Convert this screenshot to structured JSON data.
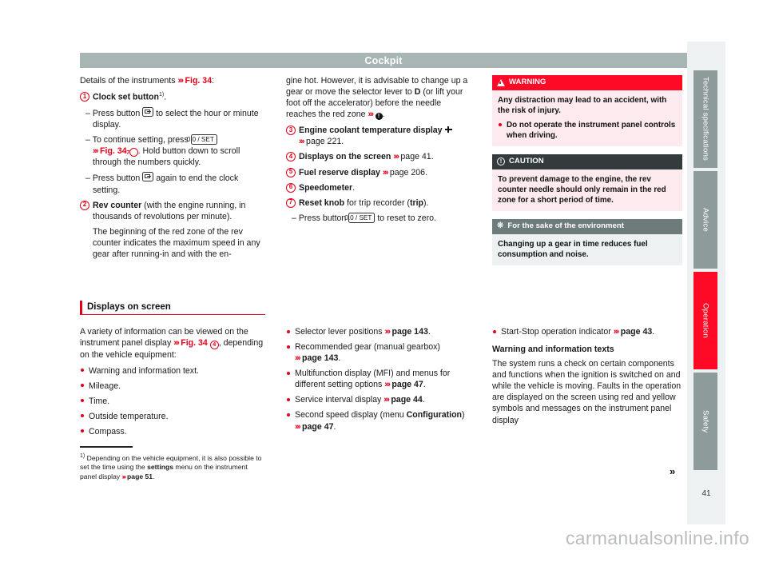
{
  "header": {
    "title": "Cockpit"
  },
  "column1": {
    "intro_pre": "Details of the instruments ",
    "intro_ref": "Fig. 34",
    "intro_post": ":",
    "item1": {
      "num": "1",
      "label": "Clock set button",
      "footnote_marker": "1)",
      "tail": "."
    },
    "item1_dash1_pre": "– Press button ",
    "item1_dash1_post": " to select the hour or minute display.",
    "item1_dash2_pre": "– To continue setting, press ",
    "item1_dash2_key": "0.0 / SET",
    "item1_dash2_ref": "Fig. 34",
    "item1_dash2_refnum": "7",
    "item1_dash2_post": ". Hold button down to scroll through the numbers quickly.",
    "item1_dash3_pre": "– Press button ",
    "item1_dash3_post": " again to end the clock setting.",
    "item2": {
      "num": "2",
      "label": "Rev counter",
      "tail": " (with the engine running, in thousands of revolutions per minute)."
    },
    "item2_para": "The beginning of the red zone of the rev counter indicates the maximum speed in any gear after running-in and with the en-"
  },
  "column2": {
    "cont_para": "gine hot. However, it is advisable to change up a gear or move the selector lever to ",
    "cont_bold_d": "D",
    "cont_para2": " (or lift your foot off the accelerator) before the needle reaches the red zone ",
    "cont_para_end": ".",
    "item3": {
      "num": "3",
      "label": "Engine coolant temperature display",
      "ref": "page 221",
      "tail": "."
    },
    "item4": {
      "num": "4",
      "label": "Displays on the screen",
      "ref": "page 41",
      "tail": "."
    },
    "item5": {
      "num": "5",
      "label": "Fuel reserve display",
      "ref": "page 206",
      "tail": "."
    },
    "item6": {
      "num": "6",
      "label": "Speedometer",
      "tail": "."
    },
    "item7": {
      "num": "7",
      "label": "Reset knob",
      "mid": " for trip recorder (",
      "bold2": "trip",
      "tail": ")."
    },
    "item7_dash_pre": "– Press button ",
    "item7_dash_key": "0.0 / SET",
    "item7_dash_post": " to reset to zero."
  },
  "column3": {
    "warning": {
      "icon": "warning-triangle-icon",
      "title": "WARNING",
      "body": "Any distraction may lead to an accident, with the risk of injury.",
      "bullet": "Do not operate the instrument panel controls when driving."
    },
    "caution": {
      "icon": "caution-circle-icon",
      "title": "CAUTION",
      "body": "To prevent damage to the engine, the rev counter needle should only remain in the red zone for a short period of time."
    },
    "environment": {
      "icon": "environment-flower-icon",
      "title": "For the sake of the environment",
      "body": "Changing up a gear in time reduces fuel consumption and noise."
    }
  },
  "section": {
    "heading": "Displays on screen",
    "intro_pre": "A variety of information can be viewed on the instrument panel display ",
    "intro_ref": "Fig. 34",
    "intro_refnum": "4",
    "intro_post": ", depending on the vehicle equipment:",
    "bullets_left": [
      "Warning and information text.",
      "Mileage.",
      "Time.",
      "Outside temperature.",
      "Compass."
    ],
    "bullets_mid": [
      {
        "text": "Selector lever positions ",
        "ref": "page 143",
        "tail": "."
      },
      {
        "text": "Recommended gear (manual gearbox) ",
        "ref": "page 143",
        "tail": "."
      },
      {
        "text": "Multifunction display (MFI) and menus for different setting options ",
        "ref": "page 47",
        "tail": "."
      },
      {
        "text": "Service interval display ",
        "ref": "page 44",
        "tail": "."
      },
      {
        "text": "Second speed display (menu ",
        "bold": "Configuration",
        "text2": ") ",
        "ref": "page 47",
        "tail": "."
      }
    ],
    "bullet_right": {
      "text": "Start-Stop operation indicator ",
      "ref": "page 43",
      "tail": "."
    },
    "right_heading": "Warning and information texts",
    "right_body": "The system runs a check on certain components and functions when the ignition is switched on and while the vehicle is moving. Faults in the operation are displayed on the screen using red and yellow symbols and messages on the instrument panel display"
  },
  "footnote": {
    "marker": "1)",
    "pre": " Depending on the vehicle equipment, it is also possible to set the time using the ",
    "bold": "settings",
    "mid": " menu on the instrument panel display ",
    "ref": "page 51",
    "tail": "."
  },
  "tabs": [
    {
      "label": "Technical specifications",
      "color": "#8e9b9b",
      "active": false
    },
    {
      "label": "Advice",
      "color": "#8e9b9b",
      "active": false
    },
    {
      "label": "Operation",
      "color": "#ff0a26",
      "active": true
    },
    {
      "label": "Safety",
      "color": "#8e9b9b",
      "active": false
    }
  ],
  "page_number": "41",
  "continuation_arrow": "»",
  "watermark": "carmanualsonline.info",
  "colors": {
    "accent_red": "#e3001b",
    "tab_red": "#ff0a26",
    "head_grey": "#a7b5b5",
    "tab_grey": "#8e9b9b"
  }
}
